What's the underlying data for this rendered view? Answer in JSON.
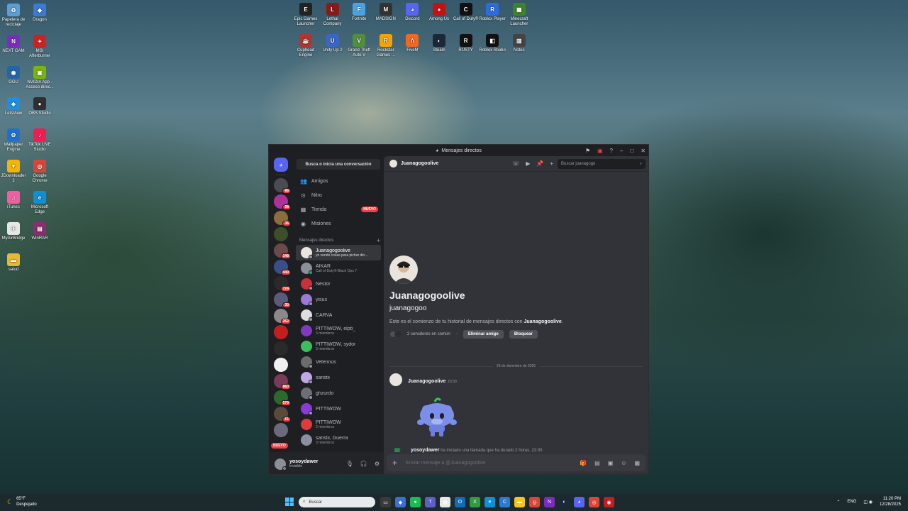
{
  "desktop": {
    "left_icons": [
      {
        "label": "Papelera de reciclaje",
        "color": "#5aa0d8",
        "glyph": "♻"
      },
      {
        "label": "Dragon",
        "color": "#3a7bd5",
        "glyph": "◆"
      },
      {
        "label": "NEXT GAM",
        "color": "#7b2bbf",
        "glyph": "N"
      },
      {
        "label": "MSI Afterburner",
        "color": "#c22",
        "glyph": "✦"
      },
      {
        "label": "GGU",
        "color": "#2266aa",
        "glyph": "◉"
      },
      {
        "label": "NVIDIA App - Acceso direc...",
        "color": "#76b900",
        "glyph": "▣"
      },
      {
        "label": "LetsView",
        "color": "#1b8fe3",
        "glyph": "◈"
      },
      {
        "label": "OBS Studio",
        "color": "#302e31",
        "glyph": "●"
      },
      {
        "label": "Wallpaper Engine",
        "color": "#1f6fd1",
        "glyph": "⚙"
      },
      {
        "label": "TikTok LIVE Studio",
        "color": "#ee1d52",
        "glyph": "♪"
      },
      {
        "label": "JDownloader 2",
        "color": "#f5b400",
        "glyph": "▼"
      },
      {
        "label": "Google Chrome",
        "color": "#db4437",
        "glyph": "◎"
      },
      {
        "label": "iTunes",
        "color": "#f25fa1",
        "glyph": "♫"
      },
      {
        "label": "Microsoft Edge",
        "color": "#0f8fd8",
        "glyph": "e"
      },
      {
        "label": "MyAirBridge",
        "color": "#e6e6e6",
        "glyph": "✈"
      },
      {
        "label": "WinRAR",
        "color": "#8b2d6e",
        "glyph": "▤"
      },
      {
        "label": "salud",
        "color": "#e8b830",
        "glyph": "▬"
      }
    ],
    "top_icons": [
      {
        "label": "Epic Games Launcher",
        "color": "#222",
        "glyph": "E"
      },
      {
        "label": "Lethal Company",
        "color": "#8a1a1a",
        "glyph": "L"
      },
      {
        "label": "Fortnite",
        "color": "#4aa3e0",
        "glyph": "F"
      },
      {
        "label": "MADSIGN",
        "color": "#333",
        "glyph": "M"
      },
      {
        "label": "Discord",
        "color": "#5865f2",
        "glyph": "◕"
      },
      {
        "label": "Among Us",
        "color": "#c51111",
        "glyph": "●"
      },
      {
        "label": "Call of Duty®",
        "color": "#111",
        "glyph": "C"
      },
      {
        "label": "Roblox Player",
        "color": "#2d6cdf",
        "glyph": "R"
      },
      {
        "label": "Minecraft Launcher",
        "color": "#3c8527",
        "glyph": "▦"
      },
      {
        "label": "Cuphead Engine",
        "color": "#b4342f",
        "glyph": "☕"
      },
      {
        "label": "Unity Up 2",
        "color": "#3a66c4",
        "glyph": "U"
      },
      {
        "label": "Grand Theft Auto V",
        "color": "#4f8f3e",
        "glyph": "V"
      },
      {
        "label": "Rockstar Games ...",
        "color": "#f4a300",
        "glyph": "R"
      },
      {
        "label": "FiveM",
        "color": "#f26722",
        "glyph": "Λ"
      },
      {
        "label": "Steam",
        "color": "#1b2838",
        "glyph": "◐"
      },
      {
        "label": "RUSTY",
        "color": "#111",
        "glyph": "R"
      },
      {
        "label": "Roblox Studio",
        "color": "#111",
        "glyph": "◧"
      },
      {
        "label": "Notes",
        "color": "#444",
        "glyph": "▥"
      }
    ]
  },
  "window": {
    "title": "Mensajes directos",
    "search_conversation": "Busca o inicia una conversación",
    "nav": [
      {
        "label": "Amigos",
        "icon": "friends-icon",
        "glyph": "👥"
      },
      {
        "label": "Nitro",
        "icon": "nitro-icon",
        "glyph": "⊙"
      },
      {
        "label": "Tienda",
        "icon": "store-icon",
        "glyph": "▦",
        "badge": "NUEVO"
      },
      {
        "label": "Misiones",
        "icon": "quests-icon",
        "glyph": "◉"
      }
    ],
    "dm_header": "Mensajes directos",
    "dm_add": "+",
    "dms": [
      {
        "name": "Juanagogoolive",
        "sub": "yo vendo cosas para pichar din...",
        "active": true,
        "color": "#e9e4dd",
        "status": "#949ba4"
      },
      {
        "name": "AIKAR",
        "sub": "Call of Duty® Black Ops 7",
        "color": "#8a8f98",
        "status": "#23a55a"
      },
      {
        "name": "Néstor",
        "sub": "",
        "color": "#c9303a",
        "status": "#949ba4"
      },
      {
        "name": "yisus",
        "sub": "",
        "color": "#9a7ad6",
        "status": "#949ba4"
      },
      {
        "name": "CARVA",
        "sub": "",
        "color": "#dddddd",
        "status": "#949ba4"
      },
      {
        "name": "PITTIWOW, elpb_",
        "sub": "3 miembros",
        "color": "#7e3bbf",
        "status": ""
      },
      {
        "name": "PITTIWOW, sydor",
        "sub": "3 miembros",
        "color": "#3bbf5c",
        "status": ""
      },
      {
        "name": "Velennus",
        "sub": "",
        "color": "#6c6c6c",
        "status": "#949ba4"
      },
      {
        "name": "saristii",
        "sub": "",
        "color": "#c0a8e8",
        "status": "#949ba4"
      },
      {
        "name": "ghzurdo",
        "sub": "",
        "color": "#6d6f78",
        "status": "#949ba4"
      },
      {
        "name": "PITTIWOW",
        "sub": "",
        "color": "#8a3bd6",
        "status": "#949ba4"
      },
      {
        "name": "PITTIWOW",
        "sub": "2 miembros",
        "color": "#e03b3b",
        "status": ""
      },
      {
        "name": "saristii, Guerra",
        "sub": "3 miembros",
        "color": "#8c8fa0",
        "status": ""
      }
    ],
    "guilds": [
      {
        "badge": "66",
        "color": "#4a4c52"
      },
      {
        "badge": "58",
        "color": "#b0309a"
      },
      {
        "badge": "36",
        "color": "#8c6d3c"
      },
      {
        "badge": "",
        "color": "#3b4f2a"
      },
      {
        "badge": "148",
        "color": "#6b4a4a"
      },
      {
        "badge": "440",
        "color": "#3a4f8a"
      },
      {
        "badge": "724",
        "color": "#2a2a2a"
      },
      {
        "badge": "30",
        "color": "#5a5a7a"
      },
      {
        "badge": "262",
        "color": "#8a8a8a"
      },
      {
        "badge": "",
        "color": "#c22020"
      },
      {
        "badge": "",
        "color": "#2a2a2a"
      },
      {
        "badge": "",
        "color": "#f0f0f0"
      },
      {
        "badge": "860",
        "color": "#7a3a5a"
      },
      {
        "badge": "579",
        "color": "#2a6a2a"
      },
      {
        "badge": "61",
        "color": "#5a4a3a"
      },
      {
        "badge": "",
        "color": "#6a6a7a"
      }
    ],
    "guild_new_label": "NUEVO",
    "user": {
      "name": "yosoydawer",
      "status": "Invisible"
    },
    "channel": {
      "name": "Juanagogoolive",
      "search_placeholder": "Buscar juanagogo"
    },
    "intro": {
      "display_name": "Juanagogoolive",
      "username": "juanagogoo",
      "desc_prefix": "Este es el comienzo de tu historial de mensajes directos con ",
      "desc_name": "Juanagogoolive",
      "desc_suffix": ".",
      "mutual": "2 servidores en común",
      "remove_friend": "Eliminar amigo",
      "block": "Bloquear"
    },
    "date_divider": "26 de diciembre de 2025",
    "message": {
      "author": "Juanagogoolive",
      "time": "23:30"
    },
    "system_message": {
      "user": "yosoydawer",
      "text": " ha iniciado una llamada que ha durado 2 horas.",
      "time": "23:35"
    },
    "composer_placeholder": "Enviar mensaje a @Juanagogoolive"
  },
  "taskbar": {
    "weather_temp": "65°F",
    "weather_desc": "Despejado",
    "search": "Buscar",
    "apps": [
      {
        "color": "#3a3a3a",
        "glyph": "▭"
      },
      {
        "color": "#3b6fd6",
        "glyph": "◆"
      },
      {
        "color": "#1db954",
        "glyph": "●"
      },
      {
        "color": "#5b5fc7",
        "glyph": "T"
      },
      {
        "color": "#e8e8e8",
        "glyph": "▦"
      },
      {
        "color": "#0f6cbd",
        "glyph": "O"
      },
      {
        "color": "#2e9c3f",
        "glyph": "X"
      },
      {
        "color": "#0f8fd8",
        "glyph": "e"
      },
      {
        "color": "#2a7ad6",
        "glyph": "C"
      },
      {
        "color": "#f5c518",
        "glyph": "▬"
      },
      {
        "color": "#db4437",
        "glyph": "◎"
      },
      {
        "color": "#7b2bbf",
        "glyph": "N"
      },
      {
        "color": "#1b2838",
        "glyph": "◐"
      },
      {
        "color": "#5865f2",
        "glyph": "◕"
      },
      {
        "color": "#db4437",
        "glyph": "◎"
      },
      {
        "color": "#c22020",
        "glyph": "◉"
      }
    ],
    "language": "ENG",
    "time": "11:20 PM",
    "date": "12/28/2025"
  }
}
